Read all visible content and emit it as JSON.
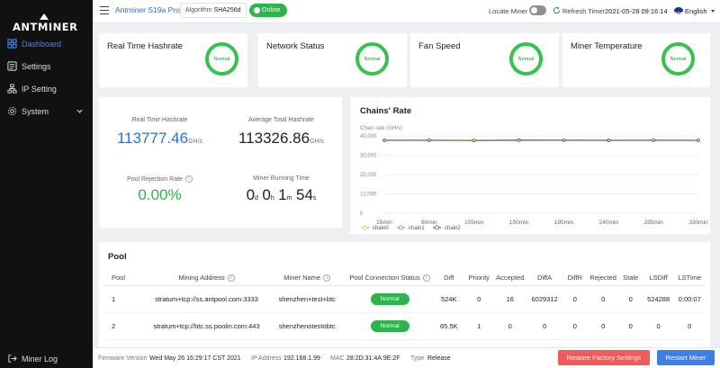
{
  "sidebar": {
    "logo": "ANTMINER",
    "items": [
      {
        "label": "Dashboard",
        "icon": "dashboard-icon",
        "active": true
      },
      {
        "label": "Settings",
        "icon": "settings-icon"
      },
      {
        "label": "IP Setting",
        "icon": "network-icon"
      },
      {
        "label": "System",
        "icon": "system-icon"
      }
    ],
    "miner_log": "Miner Log"
  },
  "header": {
    "model": "Antminer S19a Pro",
    "algorithm_label": "Algorithm",
    "algorithm": "SHA256d",
    "status": "Online",
    "locate_miner": "Locate Miner",
    "refresh_timer_label": "Refresh Timer",
    "refresh_time": "2021-05-28 09:16:14",
    "language": "English"
  },
  "status_cards": [
    {
      "title": "Real Time Hashrate",
      "status": "Normal"
    },
    {
      "title": "Network Status",
      "status": "Normal"
    },
    {
      "title": "Fan Speed",
      "status": "Normal"
    },
    {
      "title": "Miner Temperature",
      "status": "Normal"
    }
  ],
  "stats": {
    "realtime_hashrate": {
      "label": "Real Time Hashrate",
      "value": "113777.46",
      "unit": "GH/s"
    },
    "avg_hashrate": {
      "label": "Average Total Hashrate",
      "value": "113326.86",
      "unit": "GH/s"
    },
    "pool_rejection": {
      "label": "Pool Rejection Rate",
      "value": "0.00%"
    },
    "running_time": {
      "label": "Miner Running Time",
      "d": "0",
      "d_unit": "d",
      "h": "0",
      "h_unit": "h",
      "m": "1",
      "m_unit": "m",
      "s": "54",
      "s_unit": "s"
    }
  },
  "chart_data": {
    "type": "line",
    "title": "Chains' Rate",
    "ylabel": "Chain rate (GH/s)",
    "ylim": [
      0,
      40000
    ],
    "yticks": [
      "40,000",
      "30,000",
      "20,000",
      "10,000",
      "0"
    ],
    "x": [
      "15min",
      "60min",
      "105min",
      "150min",
      "195min",
      "240min",
      "285min",
      "330min"
    ],
    "series": [
      {
        "name": "chain0",
        "color": "#d8c43a",
        "values": [
          37600,
          37700,
          37500,
          37800,
          37600,
          37700,
          37600,
          37700
        ]
      },
      {
        "name": "chain1",
        "color": "#56b56a",
        "values": [
          37800,
          37600,
          37700,
          37900,
          37700,
          37800,
          37700,
          37600
        ]
      },
      {
        "name": "chain2",
        "color": "#555555",
        "values": [
          37700,
          37800,
          37600,
          37700,
          37800,
          37600,
          37800,
          37700
        ]
      }
    ],
    "legend": "bottom-left",
    "grid": true
  },
  "pool": {
    "title": "Pool",
    "columns": [
      "Pool",
      "Mining Address",
      "Miner Name",
      "Pool Connection Status",
      "Diff",
      "Priority",
      "Accepted",
      "DiffA",
      "DiffR",
      "Rejected",
      "Stale",
      "LSDiff",
      "LSTime"
    ],
    "rows": [
      [
        "1",
        "stratum+tcp://ss.antpool.com:3333",
        "shenzhen+test+btc",
        "Normal",
        "524K",
        "0",
        "16",
        "6029312",
        "0",
        "0",
        "0",
        "524288",
        "0:00:07"
      ],
      [
        "2",
        "stratum+tcp://btc.ss.poolin.com:443",
        "shenzhenotestobtc",
        "Normal",
        "65.5K",
        "1",
        "0",
        "0",
        "0",
        "0",
        "0",
        "0",
        "0"
      ]
    ]
  },
  "footer": {
    "firmware_label": "Firmware Version",
    "firmware": "Wed May 26 16:29:17 CST 2021",
    "ip_label": "IP Address",
    "ip": "192.168.1.99",
    "mac_label": "MAC",
    "mac": "28:2D:31:4A:9E:2F",
    "type_label": "Type",
    "type": "Release",
    "restore_button": "Restore Factory Settings",
    "restart_button": "Restart Miner"
  }
}
